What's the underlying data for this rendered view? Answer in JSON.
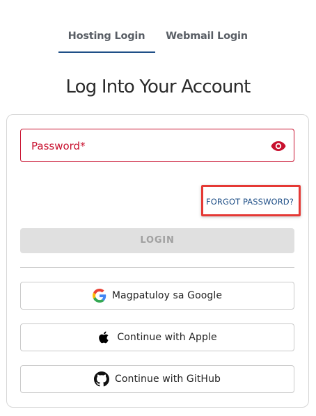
{
  "tabs": {
    "hosting": "Hosting Login",
    "webmail": "Webmail Login",
    "active": "hosting"
  },
  "title": "Log Into Your Account",
  "form": {
    "password_label": "Password*",
    "forgot_password": "FORGOT PASSWORD?",
    "login_button": "LOGIN"
  },
  "social": {
    "google": "Magpatuloy sa Google",
    "apple": "Continue with Apple",
    "github": "Continue with GitHub"
  },
  "icons": {
    "eye": "eye-icon",
    "google": "google-icon",
    "apple": "apple-icon",
    "github": "github-icon"
  },
  "colors": {
    "accent": "#1f4f87",
    "error": "#c8102e",
    "highlight": "#e53935",
    "disabled_bg": "#e0e0e0"
  }
}
